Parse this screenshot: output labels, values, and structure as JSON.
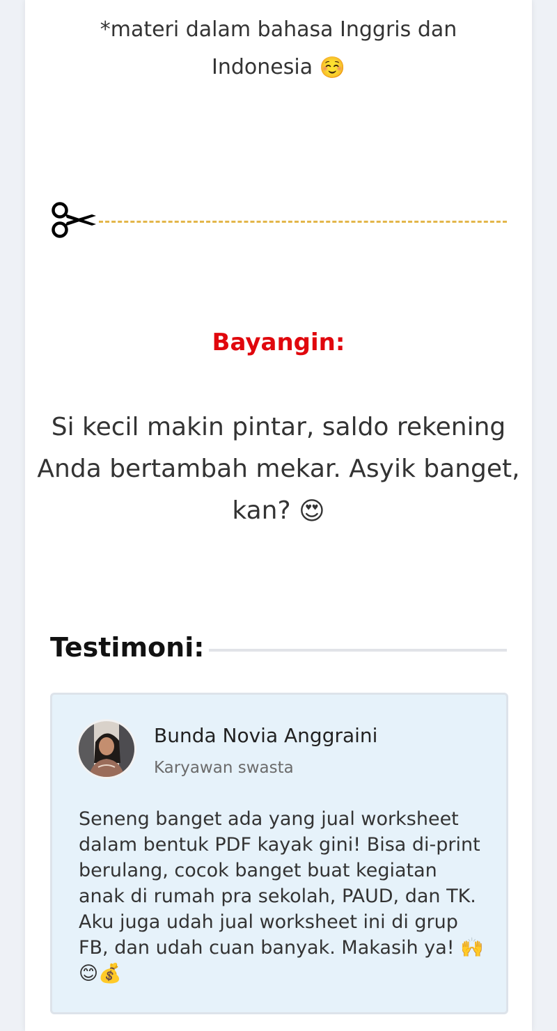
{
  "note": {
    "line1": "*materi dalam bahasa Inggris dan",
    "line2": "Indonesia",
    "emoji": "☺️"
  },
  "divider": {
    "icon": "scissors-icon",
    "line_color": "#e3b64a"
  },
  "imagine": {
    "heading": "Bayangin:",
    "heading_color": "#e0070d",
    "line1": "Si kecil makin pintar, saldo rekening",
    "line2": "Anda bertambah mekar. Asyik banget,",
    "line3": "kan?",
    "emoji": "😍"
  },
  "testimonials": {
    "heading": "Testimoni:",
    "items": [
      {
        "name": "Bunda Novia Anggraini",
        "role": "Karyawan swasta",
        "text": "Seneng banget ada yang jual worksheet dalam bentuk PDF kayak gini! Bisa di-print berulang, cocok banget buat kegiatan anak di rumah pra sekolah, PAUD, dan TK. Aku juga udah jual worksheet ini di grup FB, dan udah cuan banyak. Makasih ya!",
        "emojis": "🙌😊💰"
      }
    ]
  }
}
